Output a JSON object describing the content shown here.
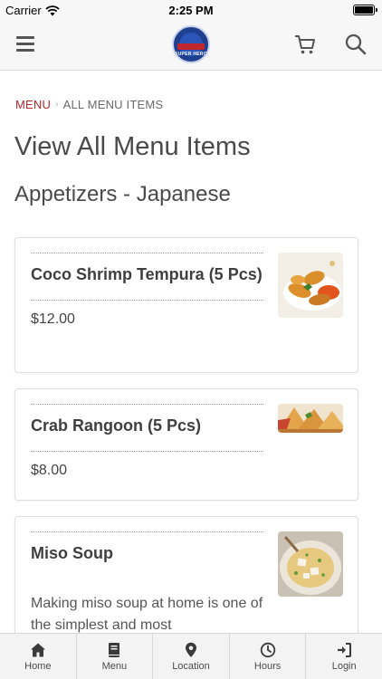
{
  "status_bar": {
    "carrier": "Carrier",
    "time": "2:25 PM"
  },
  "header": {
    "logo_text": "SUPER HERO"
  },
  "breadcrumb": {
    "menu": "MENU",
    "current": "ALL MENU ITEMS"
  },
  "page_title": "View All Menu Items",
  "section_title": "Appetizers - Japanese",
  "menu_items": [
    {
      "name": "Coco Shrimp Tempura (5 Pcs)",
      "price": "$12.00"
    },
    {
      "name": "Crab Rangoon (5 Pcs)",
      "price": "$8.00"
    },
    {
      "name": "Miso Soup",
      "description": "Making miso soup at home is one of the simplest and most"
    }
  ],
  "tab_bar": [
    {
      "label": "Home",
      "icon": "home-icon"
    },
    {
      "label": "Menu",
      "icon": "book-icon"
    },
    {
      "label": "Location",
      "icon": "map-pin-icon"
    },
    {
      "label": "Hours",
      "icon": "clock-icon"
    },
    {
      "label": "Login",
      "icon": "login-icon"
    }
  ],
  "colors": {
    "accent": "#b3282d",
    "text": "#3d3d3d",
    "header_bg": "#f7f7f7"
  }
}
